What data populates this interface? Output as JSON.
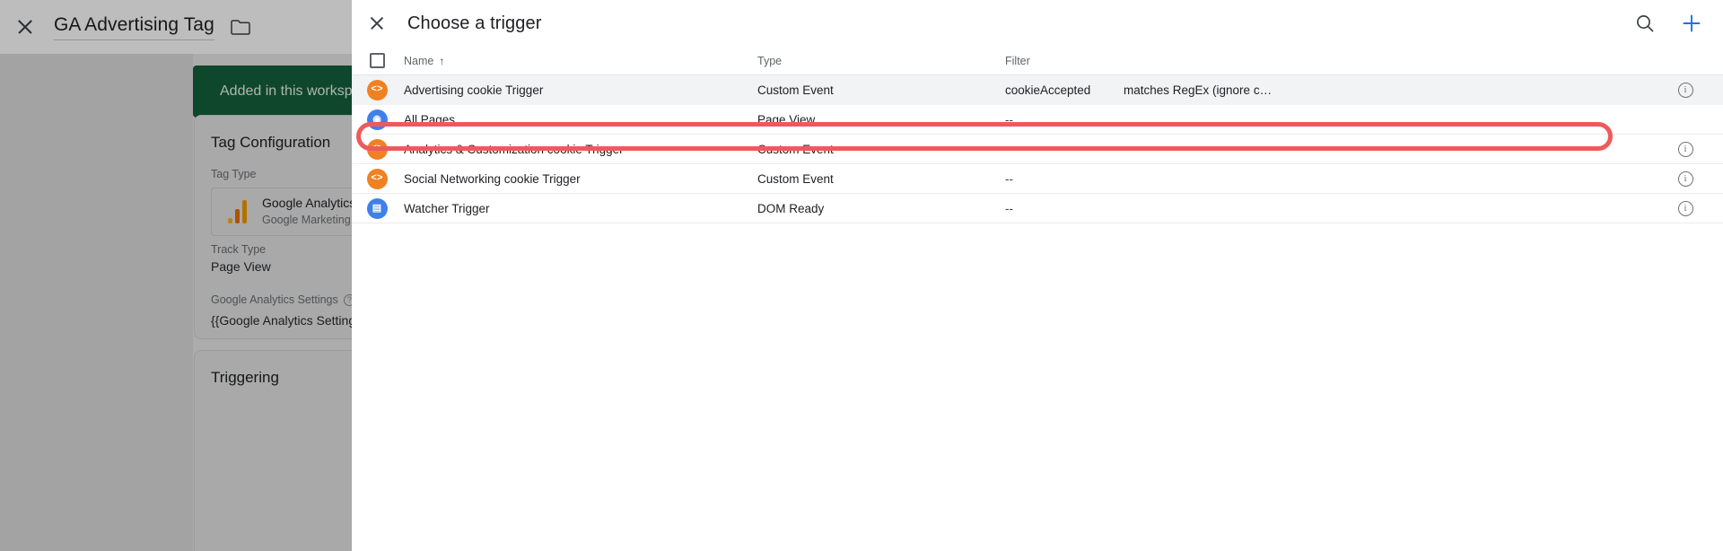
{
  "background": {
    "close_icon": "close-icon",
    "title": "GA Advertising Tag",
    "folder_icon": "folder-icon",
    "banner_text": "Added in this workspace",
    "tag_configuration": {
      "heading": "Tag Configuration",
      "tag_type_label": "Tag Type",
      "tag_type_name": "Google Analytics: Universal Analytics",
      "tag_type_sub": "Google Marketing Platform",
      "track_type_label": "Track Type",
      "track_type_value": "Page View",
      "settings_label": "Google Analytics Settings",
      "settings_value": "{{Google Analytics Settings}}"
    },
    "triggering": {
      "heading": "Triggering"
    }
  },
  "modal": {
    "close_icon": "close-icon",
    "title": "Choose a trigger",
    "search_icon": "search-icon",
    "add_icon": "plus-icon",
    "table": {
      "select_all_checkbox": "select-all-checkbox",
      "columns": {
        "name": "Name",
        "sort_indicator": "↑",
        "type": "Type",
        "filter": "Filter"
      },
      "rows": [
        {
          "name": "Advertising cookie Trigger",
          "type": "Custom Event",
          "icon": "code-icon",
          "icon_glyph": "<>",
          "icon_color": "orange",
          "filter_key": "cookieAccepted",
          "filter_op": "matches RegEx (ignore case…",
          "has_info": true,
          "selected": true,
          "annotated": true
        },
        {
          "name": "All Pages",
          "type": "Page View",
          "icon": "page-view-icon",
          "icon_glyph": "◉",
          "icon_color": "blue",
          "filter_key": "--",
          "filter_op": "",
          "has_info": false,
          "selected": false,
          "annotated": false
        },
        {
          "name": "Analytics & Customization cookie Trigger",
          "type": "Custom Event",
          "icon": "code-icon",
          "icon_glyph": "<>",
          "icon_color": "orange",
          "filter_key": "--",
          "filter_op": "",
          "has_info": true,
          "selected": false,
          "annotated": false
        },
        {
          "name": "Social Networking cookie Trigger",
          "type": "Custom Event",
          "icon": "code-icon",
          "icon_glyph": "<>",
          "icon_color": "orange",
          "filter_key": "--",
          "filter_op": "",
          "has_info": true,
          "selected": false,
          "annotated": false
        },
        {
          "name": "Watcher Trigger",
          "type": "DOM Ready",
          "icon": "document-icon",
          "icon_glyph": "▤",
          "icon_color": "blue",
          "filter_key": "--",
          "filter_op": "",
          "has_info": true,
          "selected": false,
          "annotated": false
        }
      ],
      "info_icon": "info-icon"
    }
  },
  "colors": {
    "accent_blue": "#3f80ea",
    "trigger_orange": "#ef8123",
    "banner_green": "#13613a",
    "annotation_red": "#ec5b5b",
    "selected_row": "#f1f3f4"
  }
}
